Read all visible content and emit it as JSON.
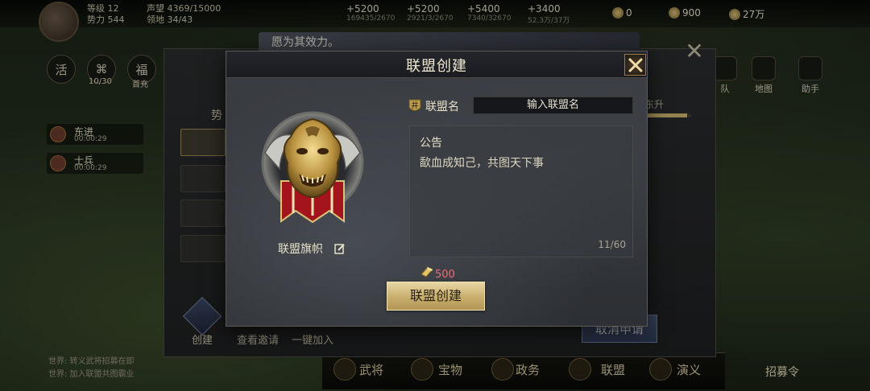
{
  "hud": {
    "stats": [
      "等级 12",
      "势力 544",
      "声望 4369/15000",
      "领地 34/43"
    ],
    "resources": [
      {
        "value": "+5200",
        "sub": "169435/2670"
      },
      {
        "value": "+5200",
        "sub": "2921/3/2670"
      },
      {
        "value": "+5400",
        "sub": "7340/32670"
      },
      {
        "value": "+3400",
        "sub": "52.3万/37万"
      }
    ],
    "currencies": [
      "0",
      "900",
      "27万"
    ]
  },
  "left_menu": {
    "buttons": [
      {
        "icon": "活",
        "tag": ""
      },
      {
        "icon": "⌘",
        "tag": "10/30"
      },
      {
        "icon": "福",
        "tag": "首充"
      }
    ],
    "marches": [
      {
        "name": "东进",
        "time": "00:00:29"
      },
      {
        "name": "士兵",
        "time": "00:00:29"
      }
    ]
  },
  "right_menu": {
    "items": [
      "队",
      "地图",
      "助手"
    ]
  },
  "bottom_bar": {
    "items": [
      "武将",
      "宝物",
      "政务",
      "联盟",
      "演义"
    ],
    "recruit": "招募令"
  },
  "chat": {
    "lines": [
      "世界: 转义武将招募在即",
      "世界: 加入联盟共图霸业"
    ]
  },
  "alliance_panel": {
    "banner_message": "愿为其效力。",
    "power_label": "势",
    "upgrade_label": "东升",
    "upgrade_progress": 0.9,
    "cancel_button": "取消申请",
    "create_label": "创建",
    "view_invites": "查看邀请",
    "quick_join": "一键加入"
  },
  "modal": {
    "title": "联盟创建",
    "banner_label": "联盟旗帜",
    "name_badge": "井",
    "name_label": "联盟名",
    "name_placeholder": "输入联盟名",
    "notice_title": "公告",
    "notice_text": "歃血成知己，共图天下事",
    "notice_count": "11/60",
    "cost_value": "500",
    "create_button": "联盟创建"
  },
  "colors": {
    "gold_button": "#c8ae6d",
    "cost_red": "#e2717a",
    "panel_dark": "#2c2f33",
    "cancel_blue": "#3c4a66"
  }
}
